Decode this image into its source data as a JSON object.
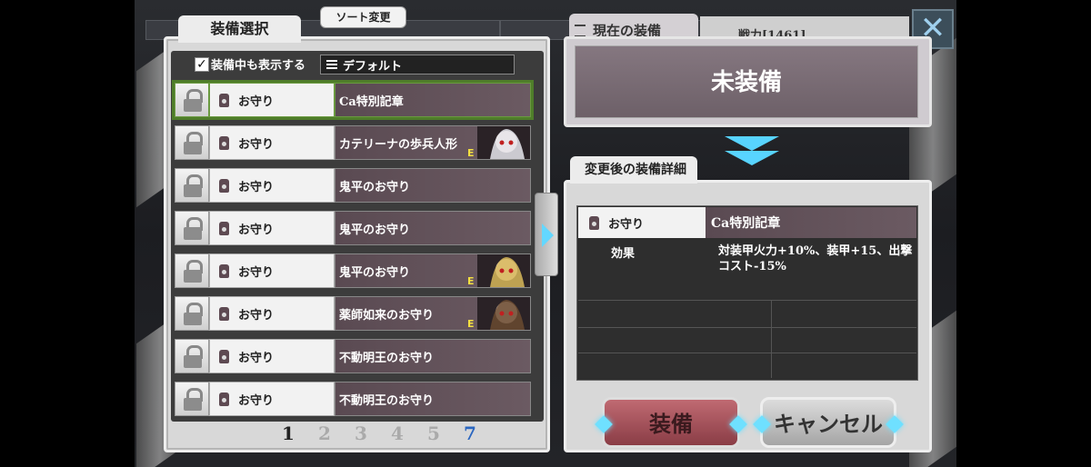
{
  "left_panel": {
    "tab_label": "装備選択",
    "sort_button_label": "ソート変更",
    "show_equipped_label": "装備中も表示する",
    "show_equipped_checked": "✓",
    "sort_mode": "デフォルト",
    "items": [
      {
        "type": "お守り",
        "name": "Ca特別記章",
        "selected": true,
        "portrait": false
      },
      {
        "type": "お守り",
        "name": "カテリーナの歩兵人形",
        "selected": false,
        "portrait": true,
        "badge": "E"
      },
      {
        "type": "お守り",
        "name": "鬼平のお守り",
        "selected": false,
        "portrait": false
      },
      {
        "type": "お守り",
        "name": "鬼平のお守り",
        "selected": false,
        "portrait": false
      },
      {
        "type": "お守り",
        "name": "鬼平のお守り",
        "selected": false,
        "portrait": true,
        "badge": "E"
      },
      {
        "type": "お守り",
        "name": "薬師如来のお守り",
        "selected": false,
        "portrait": true,
        "badge": "E"
      },
      {
        "type": "お守り",
        "name": "不動明王のお守り",
        "selected": false,
        "portrait": false
      },
      {
        "type": "お守り",
        "name": "不動明王のお守り",
        "selected": false,
        "portrait": false
      }
    ],
    "pages": [
      "1",
      "2",
      "3",
      "4",
      "5",
      "7"
    ]
  },
  "current": {
    "tab_label": "現在の装備",
    "power": "戦力[1461]",
    "value": "未装備"
  },
  "detail": {
    "tab_label": "変更後の装備詳細",
    "type": "お守り",
    "name": "Ca特別記章",
    "effect_label": "効果",
    "effect_text": "対装甲火力+10%、装甲+15、出撃コスト-15%"
  },
  "buttons": {
    "equip": "装備",
    "cancel": "キャンセル",
    "close": "✕"
  },
  "colors": {
    "accent": "#58d4ff",
    "equip_button": "#a8505a",
    "item_name_bg": "#5a4a52"
  }
}
